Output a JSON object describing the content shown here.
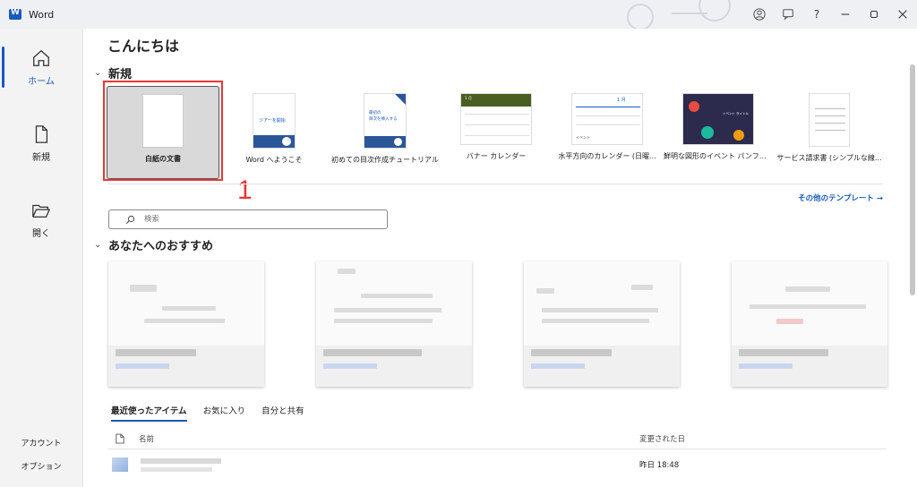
{
  "app": {
    "title": "Word"
  },
  "titlebar": {
    "help": "?"
  },
  "sidebar": {
    "items": [
      {
        "label": "ホーム",
        "icon": "home-icon",
        "active": true
      },
      {
        "label": "新規",
        "icon": "new-document-icon",
        "active": false
      },
      {
        "label": "開く",
        "icon": "folder-open-icon",
        "active": false
      }
    ],
    "account": "アカウント",
    "options": "オプション"
  },
  "main": {
    "greeting": "こんにちは",
    "new_section": "新規",
    "templates": [
      {
        "label": "白紙の文書",
        "kind": "blank"
      },
      {
        "label": "Word へようこそ",
        "kind": "welcome",
        "thumb_text": "ツアーを開始"
      },
      {
        "label": "初めての目次作成チュートリアル",
        "kind": "toc",
        "thumb_text1": "最初の",
        "thumb_text2": "目次を挿入する"
      },
      {
        "label": "バナー カレンダー",
        "kind": "banner-calendar",
        "thumb_text": "1 月"
      },
      {
        "label": "水平方向のカレンダー (日曜...",
        "kind": "horizontal-calendar",
        "thumb_text": "1 月",
        "thumb_text2": "イベント"
      },
      {
        "label": "鮮明な図形のイベント パンフレ...",
        "kind": "event-brochure",
        "thumb_text": "イベント タイトル"
      },
      {
        "label": "サービス請求書 (シンプルな線...",
        "kind": "invoice"
      }
    ],
    "annotation_number": "1",
    "more_templates": "その他のテンプレート",
    "search_placeholder": "検索",
    "recommended_section": "あなたへのおすすめ",
    "tabs": [
      {
        "label": "最近使ったアイテム",
        "active": true
      },
      {
        "label": "お気に入り",
        "active": false
      },
      {
        "label": "自分と共有",
        "active": false
      }
    ],
    "list_header": {
      "name": "名前",
      "modified": "変更された日"
    },
    "files": [
      {
        "modified": "昨日 18:48"
      }
    ]
  },
  "colors": {
    "accent": "#185abd",
    "annotation": "#e53935"
  }
}
